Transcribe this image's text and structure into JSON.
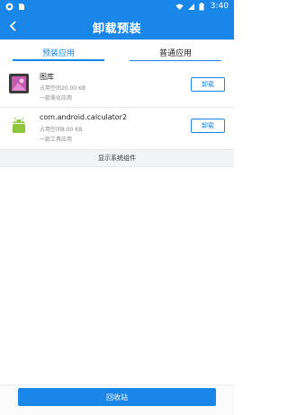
{
  "status_bar": {
    "time": "3:40",
    "bg_color": "#1a86e8"
  },
  "header": {
    "title": "卸载预装",
    "back_icon": "back-arrow-icon"
  },
  "tabs": [
    {
      "label": "预装应用",
      "active": true
    },
    {
      "label": "普通应用",
      "active": false
    }
  ],
  "apps": [
    {
      "name": "图库",
      "size": "占用空间20.00 KB",
      "category": "一款美化应用",
      "button_label": "卸载",
      "icon": "gallery-icon"
    },
    {
      "name": "com.android.calculator2",
      "size": "占用空间8.00 KB",
      "category": "一款工具应用",
      "button_label": "卸载",
      "icon": "android-robot-icon"
    }
  ],
  "show_system_label": "显示系统组件",
  "recycle_button_label": "回收站",
  "colors": {
    "accent": "#1a86e8",
    "muted_text": "#888888",
    "section_bg": "#f2f4f6"
  }
}
